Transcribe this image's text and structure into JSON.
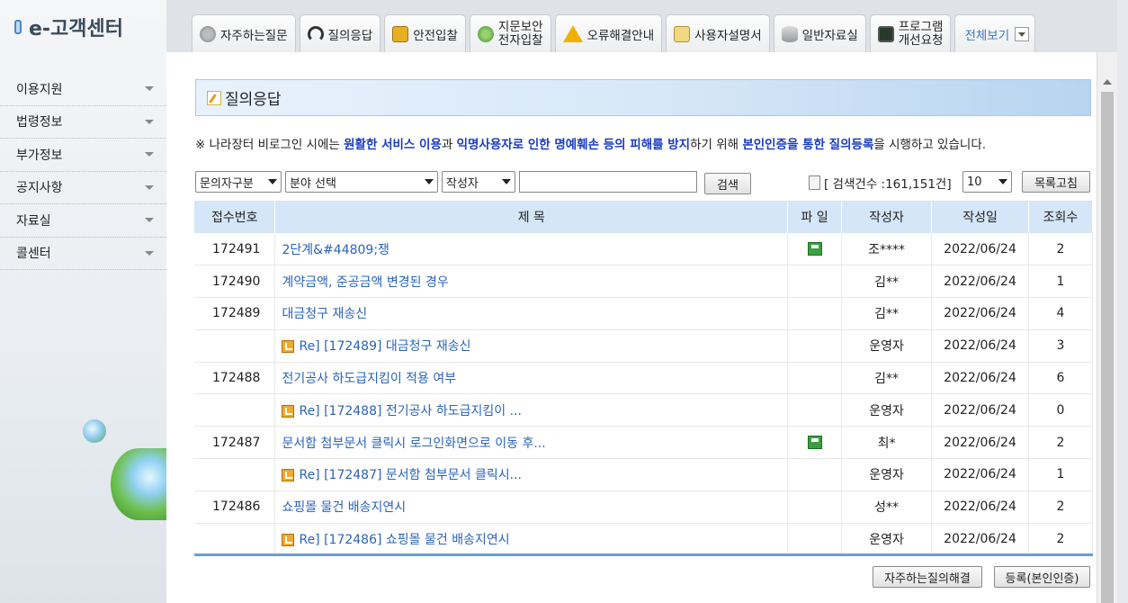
{
  "app": {
    "title": "e-고객센터"
  },
  "sidebar": {
    "items": [
      {
        "label": "이용지원"
      },
      {
        "label": "법령정보"
      },
      {
        "label": "부가정보"
      },
      {
        "label": "공지사항"
      },
      {
        "label": "자료실"
      },
      {
        "label": "콜센터"
      }
    ]
  },
  "tabs": [
    {
      "label": "자주하는질문",
      "icon": "microphone-icon"
    },
    {
      "label": "질의응답",
      "icon": "headset-icon"
    },
    {
      "label": "안전입찰",
      "icon": "lock-icon"
    },
    {
      "label": "지문보안\n전자입찰",
      "icon": "fingerprint-icon"
    },
    {
      "label": "오류해결안내",
      "icon": "warning-icon"
    },
    {
      "label": "사용자설명서",
      "icon": "manual-icon"
    },
    {
      "label": "일반자료실",
      "icon": "database-icon"
    },
    {
      "label": "프로그램\n개선요청",
      "icon": "monitor-icon"
    },
    {
      "label": "전체보기",
      "icon": "dropdown-icon"
    }
  ],
  "page": {
    "title": "질의응답",
    "notice": {
      "p1": "※ 나라장터 비로그인 시에는 ",
      "b1": "원활한 서비스 이용",
      "p2": "과 ",
      "b2": "익명사용자로 인한 명예훼손 등의 피해를 방지",
      "p3": "하기 위해 ",
      "b3": "본인인증을 통한 질의등록",
      "p4": "을 시행하고 있습니다."
    }
  },
  "search": {
    "inquirer_type": "문의자구분",
    "field_select": "분야 선택",
    "author_select": "작성자",
    "query": "",
    "search_button": "검색",
    "count_label": "[ 검색건수 :161,151건]",
    "page_size": "10",
    "refresh_button": "목록고침"
  },
  "table": {
    "headers": [
      "접수번호",
      "제 목",
      "파 일",
      "작성자",
      "작성일",
      "조회수"
    ],
    "rows": [
      {
        "no": "172491",
        "title": "2단계&#44809;쟁",
        "reply": false,
        "file": true,
        "author": "조****",
        "date": "2022/06/24",
        "views": "2"
      },
      {
        "no": "172490",
        "title": "계약금액, 준공금액 변경된 경우",
        "reply": false,
        "file": false,
        "author": "김**",
        "date": "2022/06/24",
        "views": "1"
      },
      {
        "no": "172489",
        "title": "대금청구 재송신",
        "reply": false,
        "file": false,
        "author": "김**",
        "date": "2022/06/24",
        "views": "4"
      },
      {
        "no": "",
        "title": "Re] [172489] 대금청구 재송신",
        "reply": true,
        "file": false,
        "author": "운영자",
        "date": "2022/06/24",
        "views": "3"
      },
      {
        "no": "172488",
        "title": "전기공사 하도급지킴이 적용 여부",
        "reply": false,
        "file": false,
        "author": "김**",
        "date": "2022/06/24",
        "views": "6"
      },
      {
        "no": "",
        "title": "Re] [172488] 전기공사 하도급지킴이 ...",
        "reply": true,
        "file": false,
        "author": "운영자",
        "date": "2022/06/24",
        "views": "0"
      },
      {
        "no": "172487",
        "title": "문서함 첨부문서 클릭시 로그인화면으로 이동 후...",
        "reply": false,
        "file": true,
        "author": "최*",
        "date": "2022/06/24",
        "views": "2"
      },
      {
        "no": "",
        "title": "Re] [172487] 문서함 첨부문서 클릭시...",
        "reply": true,
        "file": false,
        "author": "운영자",
        "date": "2022/06/24",
        "views": "1"
      },
      {
        "no": "172486",
        "title": "쇼핑몰 물건 배송지연시",
        "reply": false,
        "file": false,
        "author": "성**",
        "date": "2022/06/24",
        "views": "2"
      },
      {
        "no": "",
        "title": "Re] [172486] 쇼핑몰 물건 배송지연시",
        "reply": true,
        "file": false,
        "author": "운영자",
        "date": "2022/06/24",
        "views": "2"
      }
    ]
  },
  "footer": {
    "faq_button": "자주하는질의해결",
    "register_button": "등록(본인인증)"
  }
}
